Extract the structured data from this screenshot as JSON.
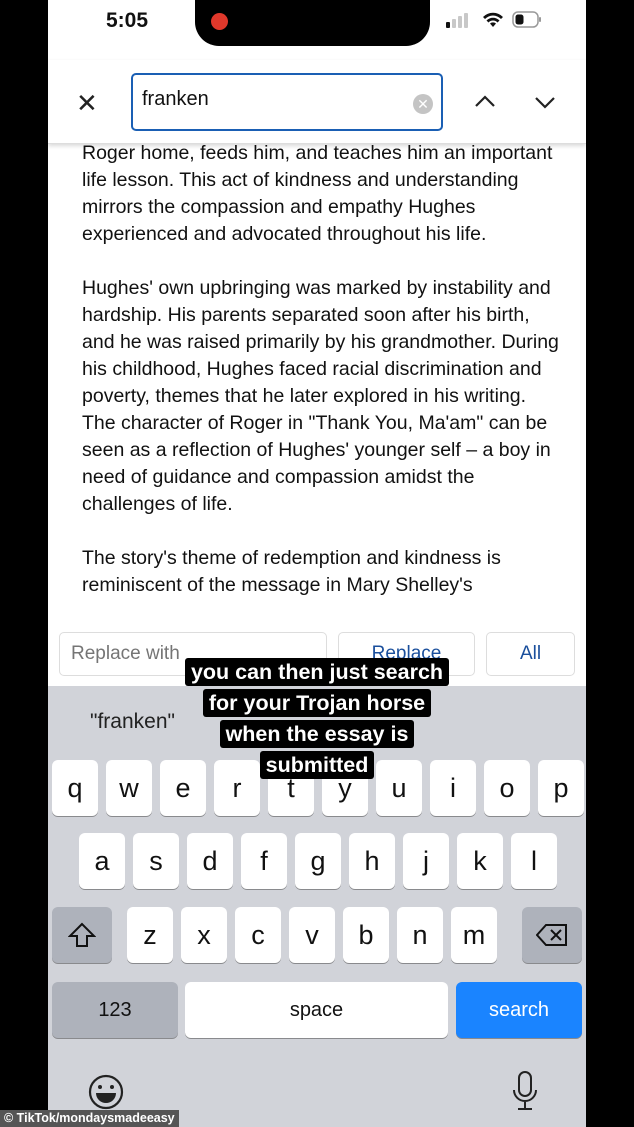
{
  "status": {
    "time": "5:05"
  },
  "find": {
    "query": "franken",
    "close_icon": "close-icon",
    "clear_icon": "clear-icon",
    "prev_icon": "chevron-up-icon",
    "next_icon": "chevron-down-icon"
  },
  "document": {
    "paragraphs": [
      "Roger home, feeds him, and teaches him an important life lesson. This act of kindness and understanding mirrors the compassion and empathy Hughes experienced and advocated throughout his life.",
      "Hughes' own upbringing was marked by instability and hardship. His parents separated soon after his birth, and he was raised primarily by his grandmother. During his childhood, Hughes faced racial discrimination and poverty, themes that he later explored in his writing. The character of Roger in \"Thank You, Ma'am\" can be seen as a reflection of Hughes' younger self – a boy in need of guidance and compassion amidst the challenges of life.",
      "The story's theme of redemption and kindness is reminiscent of the message in Mary Shelley's"
    ]
  },
  "replace": {
    "placeholder": "Replace with",
    "replace_label": "Replace",
    "all_label": "All"
  },
  "keyboard": {
    "suggestion": "\"franken\"",
    "row1": [
      "q",
      "w",
      "e",
      "r",
      "t",
      "y",
      "u",
      "i",
      "o",
      "p"
    ],
    "row2": [
      "a",
      "s",
      "d",
      "f",
      "g",
      "h",
      "j",
      "k",
      "l"
    ],
    "row3": [
      "z",
      "x",
      "c",
      "v",
      "b",
      "n",
      "m"
    ],
    "numbers_label": "123",
    "space_label": "space",
    "search_label": "search",
    "search_color": "#1a84ff"
  },
  "caption": [
    "you can then just search",
    "for your Trojan horse",
    "when the essay is",
    "submitted"
  ],
  "watermark": "© TikTok/mondaysmadeeasy"
}
